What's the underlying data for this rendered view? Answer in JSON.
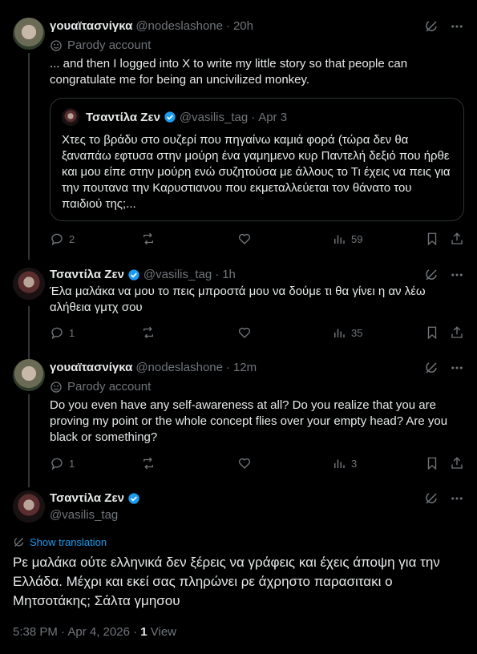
{
  "post1": {
    "name": "γουαϊτασνίγκα",
    "handle": "@nodeslashone",
    "time": "20h",
    "badge": "Parody account",
    "text": "... and then I logged into X to write my little story so that people can congratulate me for being an uncivilized monkey.",
    "quote": {
      "name": "Τσαντίλα Ζεν",
      "handle": "@vasilis_tag",
      "date": "Apr 3",
      "text": "Χτες το βράδυ στο ουζερί που πηγαίνω καμιά φορά (τώρα δεν θα ξαναπάω εφτυσα στην μούρη ένα γαμημενο κυρ Παντελή δεξιό που ήρθε και μου είπε στην μούρη ενώ συζητούσα με άλλους το Τι έχεις να πεις για την πουτανα την Καρυστιανου που εκμεταλλεύεται τον θάνατο του παιδιού της;..."
    },
    "replies": "2",
    "reposts": "",
    "likes": "",
    "views": "59"
  },
  "post2": {
    "name": "Τσαντίλα Ζεν",
    "handle": "@vasilis_tag",
    "time": "1h",
    "text": "Έλα μαλάκα να μου το πεις μπροστά μου να δούμε τι θα γίνει η αν λέω αλήθεια γμτχ σου",
    "replies": "1",
    "views": "35"
  },
  "post3": {
    "name": "γουαϊτασνίγκα",
    "handle": "@nodeslashone",
    "time": "12m",
    "badge": "Parody account",
    "text": "Do you even have any self-awareness at all? Do you realize that you are proving my point or the whole concept flies over your empty head? Are you black or something?",
    "replies": "1",
    "views": "3"
  },
  "focus": {
    "name": "Τσαντίλα Ζεν",
    "handle": "@vasilis_tag",
    "translate": "Show translation",
    "text": "Ρε μαλάκα ούτε ελληνικά δεν ξέρεις να γράφεις και έχεις άποψη για την Ελλάδα. Μέχρι και εκεί σας πληρώνει ρε άχρηστο παρασιτακι ο Μητσοτάκης; Σάλτα γμησου",
    "time": "5:38 PM · Apr 4, 2026 · ",
    "view_count": "1",
    "view_label": " View"
  },
  "sep": "·",
  "colors": {
    "bg": "#000000",
    "text": "#e7e9ea",
    "muted": "#71767b",
    "link": "#1d9bf0",
    "verified": "#1d9bf0"
  },
  "icons": [
    "grok-icon",
    "more-icon",
    "parody-icon",
    "reply-icon",
    "repost-icon",
    "like-icon",
    "views-icon",
    "bookmark-icon",
    "share-icon",
    "verified-icon",
    "translate-icon"
  ]
}
